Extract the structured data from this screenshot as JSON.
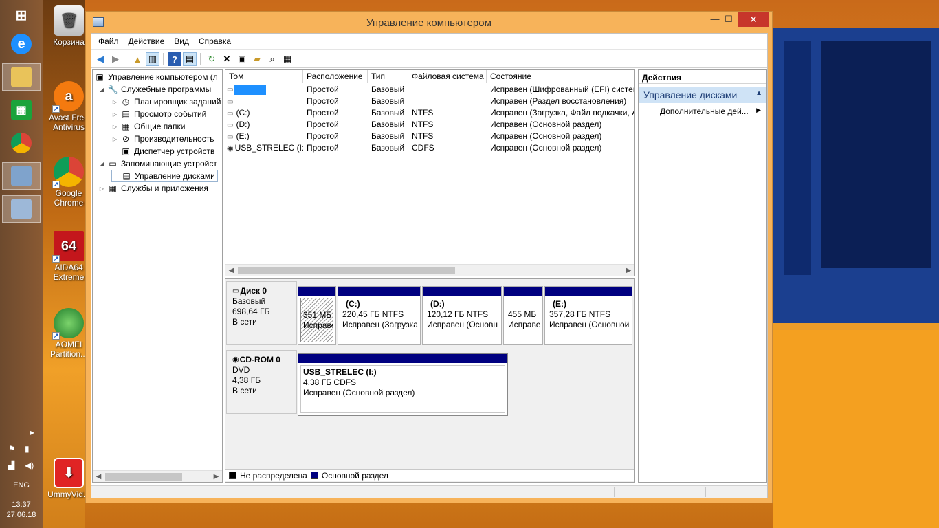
{
  "window": {
    "title": "Управление компьютером",
    "minimize": "—",
    "maximize": "☐",
    "close": "✕"
  },
  "menu": [
    "Файл",
    "Действие",
    "Вид",
    "Справка"
  ],
  "toolbar_icons": [
    "back-arrow-icon",
    "forward-arrow-icon",
    "folder-up-icon",
    "show-hide-tree-icon",
    "help-icon",
    "show-action-pane-icon",
    "refresh-icon",
    "delete-icon",
    "properties-icon",
    "open-icon",
    "search-icon",
    "export-icon"
  ],
  "tree": {
    "root": "Управление компьютером (л",
    "items": [
      {
        "label": "Служебные программы",
        "level": 1,
        "expander": "◢",
        "icon": "tools-icon"
      },
      {
        "label": "Планировщик заданий",
        "level": 2,
        "expander": "▷",
        "icon": "clock-icon"
      },
      {
        "label": "Просмотр событий",
        "level": 2,
        "expander": "▷",
        "icon": "event-viewer-icon"
      },
      {
        "label": "Общие папки",
        "level": 2,
        "expander": "▷",
        "icon": "shared-folder-icon"
      },
      {
        "label": "Производительность",
        "level": 2,
        "expander": "▷",
        "icon": "performance-icon"
      },
      {
        "label": "Диспетчер устройств",
        "level": 2,
        "expander": "",
        "icon": "device-manager-icon"
      },
      {
        "label": "Запоминающие устройст",
        "level": 1,
        "expander": "◢",
        "icon": "storage-icon"
      },
      {
        "label": "Управление дисками",
        "level": 2,
        "expander": "",
        "icon": "disk-management-icon",
        "selected": true
      },
      {
        "label": "Службы и приложения",
        "level": 1,
        "expander": "▷",
        "icon": "services-icon"
      }
    ]
  },
  "volumes": {
    "columns": [
      "Том",
      "Расположение",
      "Тип",
      "Файловая система",
      "Состояние"
    ],
    "rows": [
      [
        "",
        "Простой",
        "Базовый",
        "",
        "Исправен (Шифрованный (EFI) систем"
      ],
      [
        "",
        "Простой",
        "Базовый",
        "",
        "Исправен (Раздел восстановления)"
      ],
      [
        "(C:)",
        "Простой",
        "Базовый",
        "NTFS",
        "Исправен (Загрузка, Файл подкачки, А"
      ],
      [
        "(D:)",
        "Простой",
        "Базовый",
        "NTFS",
        "Исправен (Основной раздел)"
      ],
      [
        "(E:)",
        "Простой",
        "Базовый",
        "NTFS",
        "Исправен (Основной раздел)"
      ],
      [
        "USB_STRELEC (I:)",
        "Простой",
        "Базовый",
        "CDFS",
        "Исправен (Основной раздел)"
      ]
    ]
  },
  "disks": [
    {
      "name": "Диск 0",
      "type": "Базовый",
      "size": "698,64 ГБ",
      "status": "В сети",
      "partitions": [
        {
          "title": "",
          "size": "351 МБ",
          "status": "Исправен",
          "hatched": true
        },
        {
          "title": "(C:)",
          "size": "220,45 ГБ NTFS",
          "status": "Исправен (Загрузка"
        },
        {
          "title": "(D:)",
          "size": "120,12 ГБ NTFS",
          "status": "Исправен (Основн"
        },
        {
          "title": "",
          "size": "455 МБ",
          "status": "Исправе"
        },
        {
          "title": "(E:)",
          "size": "357,28 ГБ NTFS",
          "status": "Исправен (Основной"
        }
      ]
    },
    {
      "name": "CD-ROM 0",
      "type": "DVD",
      "size": "4,38 ГБ",
      "status": "В сети",
      "partitions": [
        {
          "title": "USB_STRELEC  (I:)",
          "size": "4,38 ГБ CDFS",
          "status": "Исправен (Основной раздел)"
        }
      ]
    }
  ],
  "legend": [
    {
      "label": "Не распределена",
      "color": "#000000"
    },
    {
      "label": "Основной раздел",
      "color": "#000080"
    }
  ],
  "actions": {
    "header": "Действия",
    "section": "Управление дисками",
    "item": "Дополнительные дей..."
  },
  "desktop_icons": [
    {
      "label": "Корзина",
      "icon": "recycle-bin-icon"
    },
    {
      "label": "Avast Free Antivirus",
      "icon": "avast-icon"
    },
    {
      "label": "Google Chrome",
      "icon": "chrome-icon"
    },
    {
      "label": "AIDA64 Extreme",
      "icon": "aida64-icon",
      "badge": "64"
    },
    {
      "label": "AOMEI Partition...",
      "icon": "aomei-icon"
    },
    {
      "label": "UmmyVid...",
      "icon": "ummy-icon"
    }
  ],
  "tray": {
    "lang": "ENG",
    "time": "13:37",
    "date": "27.06.18"
  },
  "colors": {
    "primary_partition": "#000080",
    "close_button": "#c7362b",
    "window_frame": "#f7b35a"
  }
}
